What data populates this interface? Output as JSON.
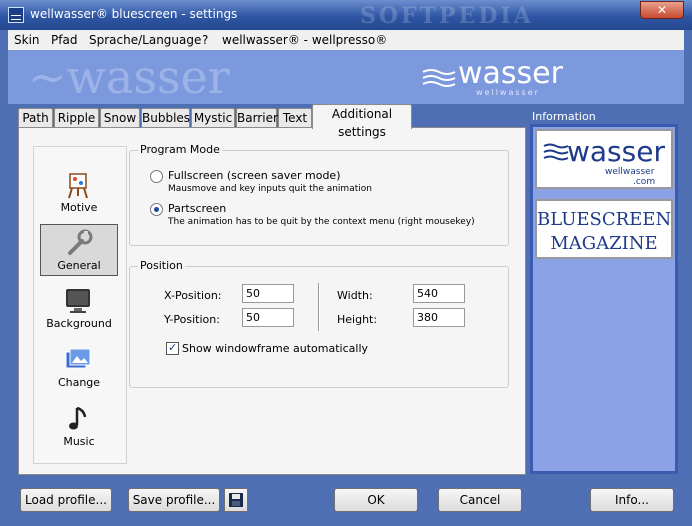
{
  "window": {
    "title": "wellwasser® bluescreen - settings",
    "close_label": "✕"
  },
  "menu": {
    "items": [
      "Skin",
      "Pfad",
      "Sprache/Language",
      "?",
      "wellwasser® - wellpresso®"
    ]
  },
  "banner": {
    "brand": "wasser",
    "brand_sub": "wellwasser"
  },
  "tabs": [
    {
      "label": "Path"
    },
    {
      "label": "Ripple"
    },
    {
      "label": "Snow"
    },
    {
      "label": "Bubbles"
    },
    {
      "label": "Mystic"
    },
    {
      "label": "Barrier"
    },
    {
      "label": "Text"
    },
    {
      "label": "Additional settings",
      "active": true
    }
  ],
  "sidebar": {
    "items": [
      {
        "label": "Motive",
        "icon": "easel-icon"
      },
      {
        "label": "General",
        "icon": "wrench-icon",
        "active": true
      },
      {
        "label": "Background",
        "icon": "monitor-icon"
      },
      {
        "label": "Change",
        "icon": "photo-icon"
      },
      {
        "label": "Music",
        "icon": "music-note-icon"
      }
    ]
  },
  "program_mode": {
    "legend": "Program Mode",
    "options": [
      {
        "label": "Fullscreen (screen saver mode)",
        "hint": "Mausmove and key inputs quit the animation",
        "selected": false
      },
      {
        "label": "Partscreen",
        "hint": "The animation has to be quit by the context menu (right mousekey)",
        "selected": true
      }
    ]
  },
  "position": {
    "legend": "Position",
    "x_label": "X-Position:",
    "x_value": "50",
    "y_label": "Y-Position:",
    "y_value": "50",
    "w_label": "Width:",
    "w_value": "540",
    "h_label": "Height:",
    "h_value": "380",
    "checkbox_label": "Show windowframe automatically",
    "checkbox_checked": true
  },
  "info": {
    "label": "Information",
    "card1_brand": "wasser",
    "card1_sub": "wellwasser",
    "card1_com": ".com",
    "card2_line1": "BLUESCREEN",
    "card2_line2": "MAGAZINE"
  },
  "buttons": {
    "load": "Load profile...",
    "save": "Save profile...",
    "ok": "OK",
    "cancel": "Cancel",
    "info": "Info..."
  },
  "colors": {
    "accent": "#2f56a5",
    "panel": "#7d99de",
    "frame": "#4e6fb4"
  }
}
